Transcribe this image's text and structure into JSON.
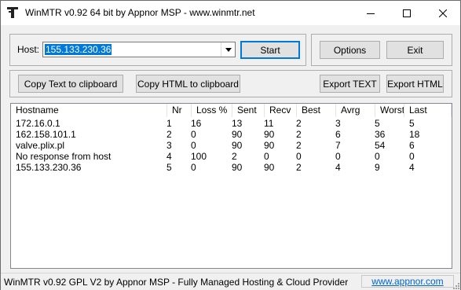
{
  "window": {
    "title": "WinMTR v0.92 64 bit by Appnor MSP - www.winmtr.net",
    "minimize_glyph": "—",
    "maximize_glyph": "☐",
    "close_glyph": "✕"
  },
  "host": {
    "label": "Host:",
    "value": "155.133.230.36"
  },
  "buttons": {
    "start": "Start",
    "options": "Options",
    "exit": "Exit",
    "copy_text": "Copy Text to clipboard",
    "copy_html": "Copy HTML to clipboard",
    "export_text": "Export TEXT",
    "export_html": "Export HTML"
  },
  "table": {
    "columns": [
      "Hostname",
      "Nr",
      "Loss %",
      "Sent",
      "Recv",
      "Best",
      "Avrg",
      "Worst",
      "Last"
    ],
    "rows": [
      [
        "172.16.0.1",
        "1",
        "16",
        "13",
        "11",
        "2",
        "3",
        "5",
        "5"
      ],
      [
        "162.158.101.1",
        "2",
        "0",
        "90",
        "90",
        "2",
        "6",
        "36",
        "18"
      ],
      [
        "valve.plix.pl",
        "3",
        "0",
        "90",
        "90",
        "2",
        "7",
        "54",
        "6"
      ],
      [
        "No response from host",
        "4",
        "100",
        "2",
        "0",
        "0",
        "0",
        "0",
        "0"
      ],
      [
        "155.133.230.36",
        "5",
        "0",
        "90",
        "90",
        "2",
        "4",
        "9",
        "4"
      ]
    ]
  },
  "status": {
    "text": "WinMTR v0.92 GPL V2 by Appnor MSP - Fully Managed Hosting & Cloud Provider",
    "link": "www.appnor.com"
  },
  "colors": {
    "selection": "#0078d7",
    "link": "#0066cc",
    "face": "#f0f0f0"
  }
}
